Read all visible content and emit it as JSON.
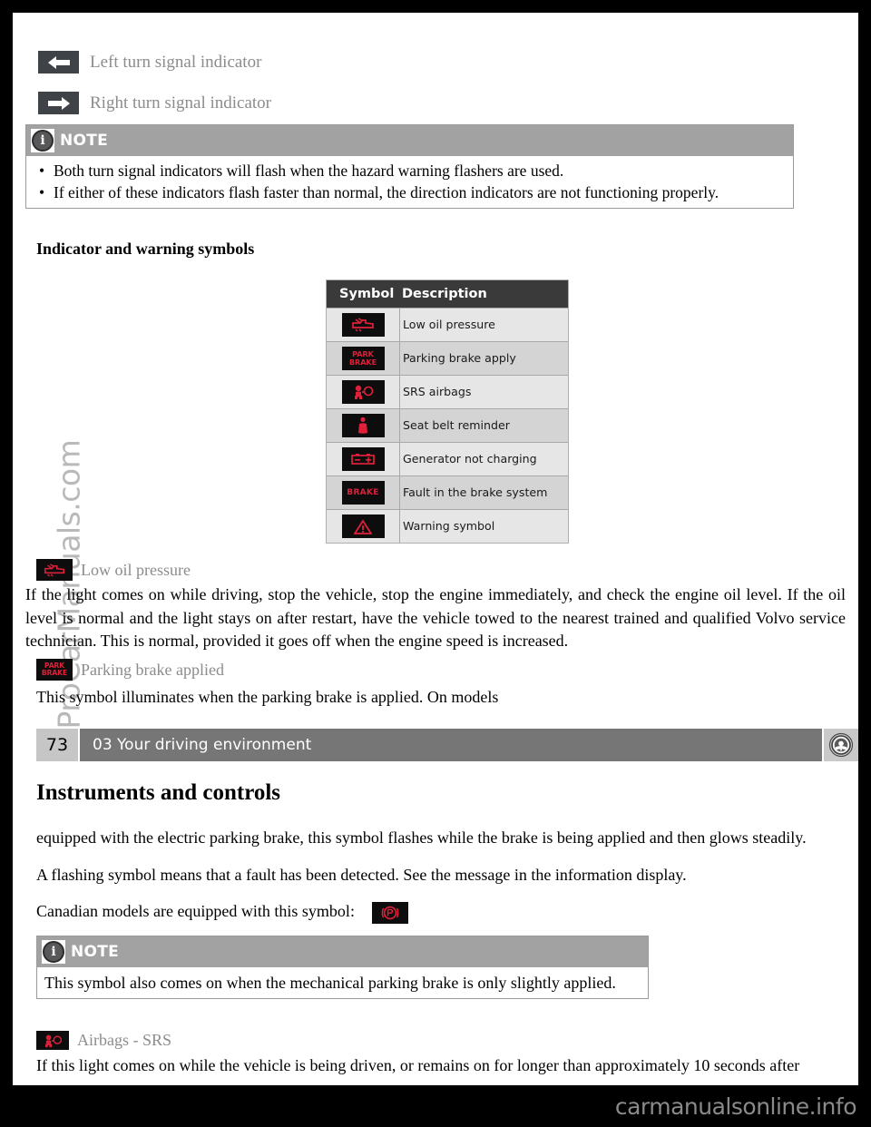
{
  "document": {
    "kind": "vehicle-owner-manual-page",
    "page_number": "73",
    "page_section": "03 Your driving environment",
    "page_heading": "Instruments and controls",
    "watermark": "ProCarManuals.com",
    "footer_brand": "carmanualsonline.info"
  },
  "turn_signals": [
    {
      "icon": "arrow-left-icon",
      "label": "Left turn signal indicator"
    },
    {
      "icon": "arrow-right-icon",
      "label": "Right turn signal indicator"
    }
  ],
  "note_top": {
    "title": "NOTE",
    "icon": "info-icon",
    "bullets": [
      "Both turn signal indicators will flash when the hazard warning flashers are used.",
      "If either of these indicators flash faster than normal, the direction indicators are not functioning properly."
    ]
  },
  "symbols_section": {
    "heading": "Indicator and warning symbols",
    "table": {
      "columns": [
        "Symbol",
        "Description"
      ],
      "rows": [
        {
          "symbol": "oil-can-icon",
          "glyph": "",
          "description": "Low oil pressure"
        },
        {
          "symbol": "park-brake-text-icon",
          "glyph": "PARK\nBRAKE",
          "description": "Parking brake apply"
        },
        {
          "symbol": "srs-airbag-icon",
          "glyph": "",
          "description": "SRS airbags"
        },
        {
          "symbol": "seat-belt-icon",
          "glyph": "",
          "description": "Seat belt reminder"
        },
        {
          "symbol": "battery-icon",
          "glyph": "",
          "description": "Generator not charging"
        },
        {
          "symbol": "brake-text-icon",
          "glyph": "BRAKE",
          "description": "Fault in the brake system"
        },
        {
          "symbol": "warning-triangle-icon",
          "glyph": "",
          "description": "Warning symbol"
        }
      ]
    }
  },
  "low_oil": {
    "icon": "oil-can-icon",
    "heading": "Low oil pressure",
    "body": "If the light comes on while driving, stop the vehicle, stop the engine immediately, and check the engine oil level. If the oil level is normal and the light stays on after restart, have the vehicle towed to the nearest trained and qualified Volvo service technician. This is normal, provided it goes off when the engine speed is increased."
  },
  "parking_brake": {
    "icon": "park-brake-text-icon",
    "heading": "Parking brake applied",
    "body_before_break": "This symbol illuminates when the parking brake is applied. On models",
    "body_after_break": "equipped with the electric parking brake, this symbol flashes while the brake is being applied and then glows steadily.",
    "fault_text": "A flashing symbol means that a fault has been detected. See the message in the information display.",
    "canadian_text": "Canadian models are equipped with this symbol:",
    "canadian_symbol": "p-in-circle-icon"
  },
  "note_bottom": {
    "title": "NOTE",
    "icon": "info-icon",
    "text": "This symbol also comes on when the mechanical parking brake is only slightly applied."
  },
  "airbags": {
    "icon": "srs-airbag-icon",
    "heading": "Airbags - SRS",
    "body": "If this light comes on while the vehicle is being driven, or remains on for longer than approximately 10 seconds after"
  },
  "colors": {
    "note_header_bg": "#a2a2a2",
    "table_header_bg": "#3a3a3a",
    "table_row_light": "#e6e6e6",
    "table_row_dark": "#d4d4d4",
    "symbol_red": "#e0203a",
    "pagebar_bg": "#767676",
    "pagenum_bg": "#c6c6c6",
    "muted_label": "#8c8c8c",
    "badge_bg": "#3f4246",
    "page_bg": "#ffffff",
    "outer_bg": "#000000"
  }
}
